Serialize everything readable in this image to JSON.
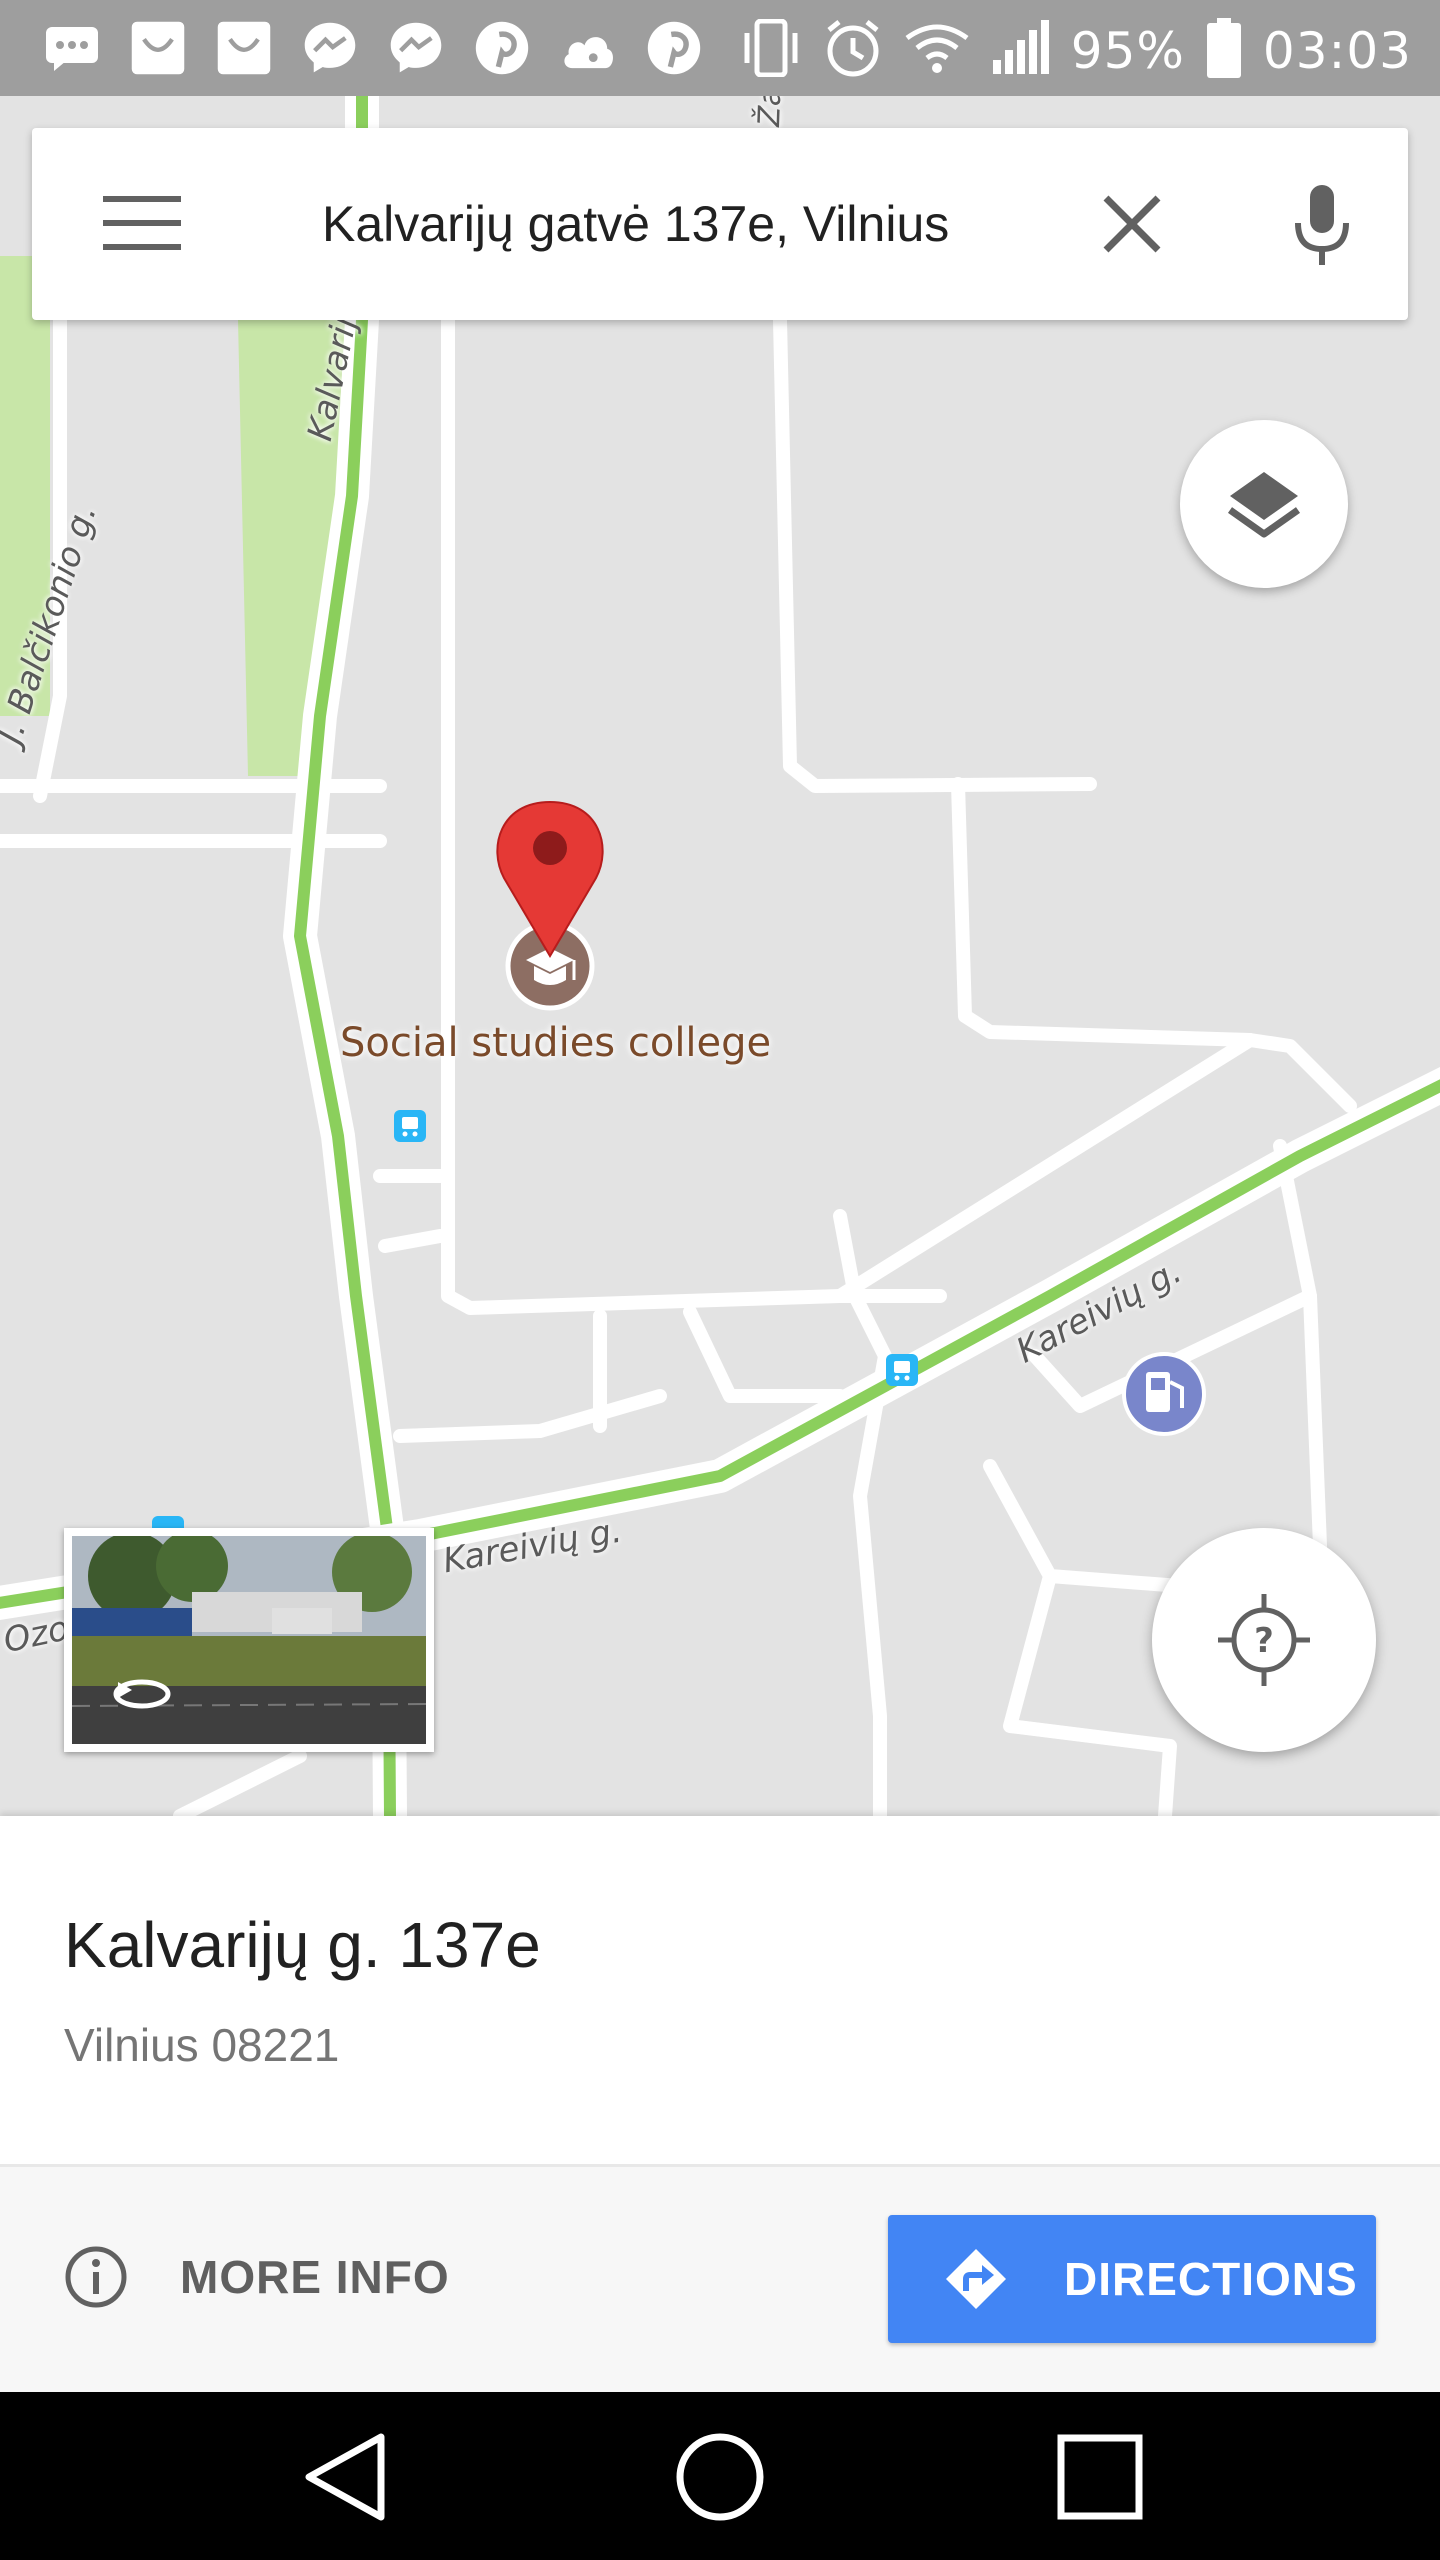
{
  "status_bar": {
    "battery": "95%",
    "time": "03:03",
    "notification_icons": [
      "sms-icon",
      "smile-app-icon",
      "smile-app-icon",
      "messenger-icon",
      "messenger-icon",
      "pinterest-icon",
      "cloud-icon",
      "pinterest-icon"
    ],
    "system_icons": [
      "vibrate-icon",
      "alarm-icon",
      "wifi-icon",
      "signal-icon",
      "battery-icon"
    ]
  },
  "search": {
    "query": "Kalvarijų gatvė 137e, Vilnius"
  },
  "map": {
    "place_name": "Social studies college",
    "road_labels": {
      "kalvariju": "Kalvarijų g.",
      "balcikonio": "J. Balčikonio g.",
      "zalgirio": "Žalgirio g.",
      "kareiviu_east": "Kareivių g.",
      "kareiviu_west": "Kareivių g.",
      "ozo": "Ozo"
    },
    "colors": {
      "map_background": "#e3e3e3",
      "road": "#ffffff",
      "major_road_traffic": "#8bcf5c",
      "park": "#c8e6a8",
      "marker": "#e53935",
      "place_icon": "#8d6e63",
      "transit": "#29b6f6",
      "gas_station": "#7986cb"
    }
  },
  "place": {
    "address": "Kalvarijų g. 137e",
    "locality": "Vilnius 08221"
  },
  "actions": {
    "more_info": "MORE INFO",
    "directions": "DIRECTIONS",
    "directions_color": "#4285f4"
  }
}
